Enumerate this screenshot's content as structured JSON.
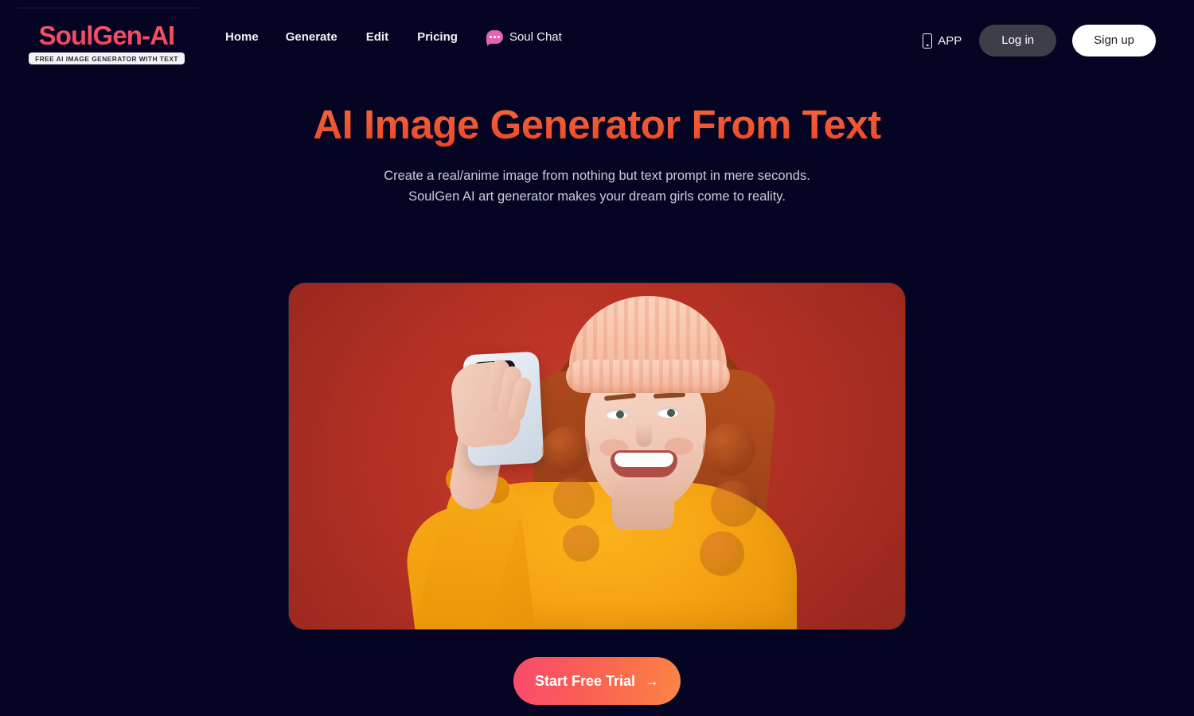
{
  "brand": {
    "logo_text": "SoulGen-AI",
    "logo_badge": "FREE AI IMAGE GENERATOR WITH TEXT",
    "logo_color": "#F4516B"
  },
  "nav": {
    "items": [
      {
        "label": "Home"
      },
      {
        "label": "Generate"
      },
      {
        "label": "Edit"
      },
      {
        "label": "Pricing"
      }
    ],
    "chat": {
      "label": "Soul Chat",
      "icon": "chat-bubble-icon",
      "icon_color": "#E85FB4"
    }
  },
  "header_actions": {
    "app": {
      "label": "APP",
      "icon": "phone-icon"
    },
    "login": {
      "label": "Log in",
      "bg": "#3E3E49"
    },
    "signup": {
      "label": "Sign up",
      "bg": "#FFFFFF"
    }
  },
  "hero": {
    "title": "AI Image Generator From Text",
    "title_color": "#F0512F",
    "subtitle_line1": "Create a real/anime image from nothing but text prompt in mere seconds.",
    "subtitle_line2": "SoulGen AI art generator makes your dream girls come to reality.",
    "image_alt": "Smiling young woman with curly red hair wearing a peach knit beanie and orange sweater taking a selfie with a white smartphone against a red background",
    "image_bg_color": "#BE3427"
  },
  "cta": {
    "label": "Start Free Trial",
    "arrow": "→",
    "gradient_from": "#F94A6E",
    "gradient_to": "#FB8545"
  },
  "theme": {
    "page_bg": "#050523"
  }
}
